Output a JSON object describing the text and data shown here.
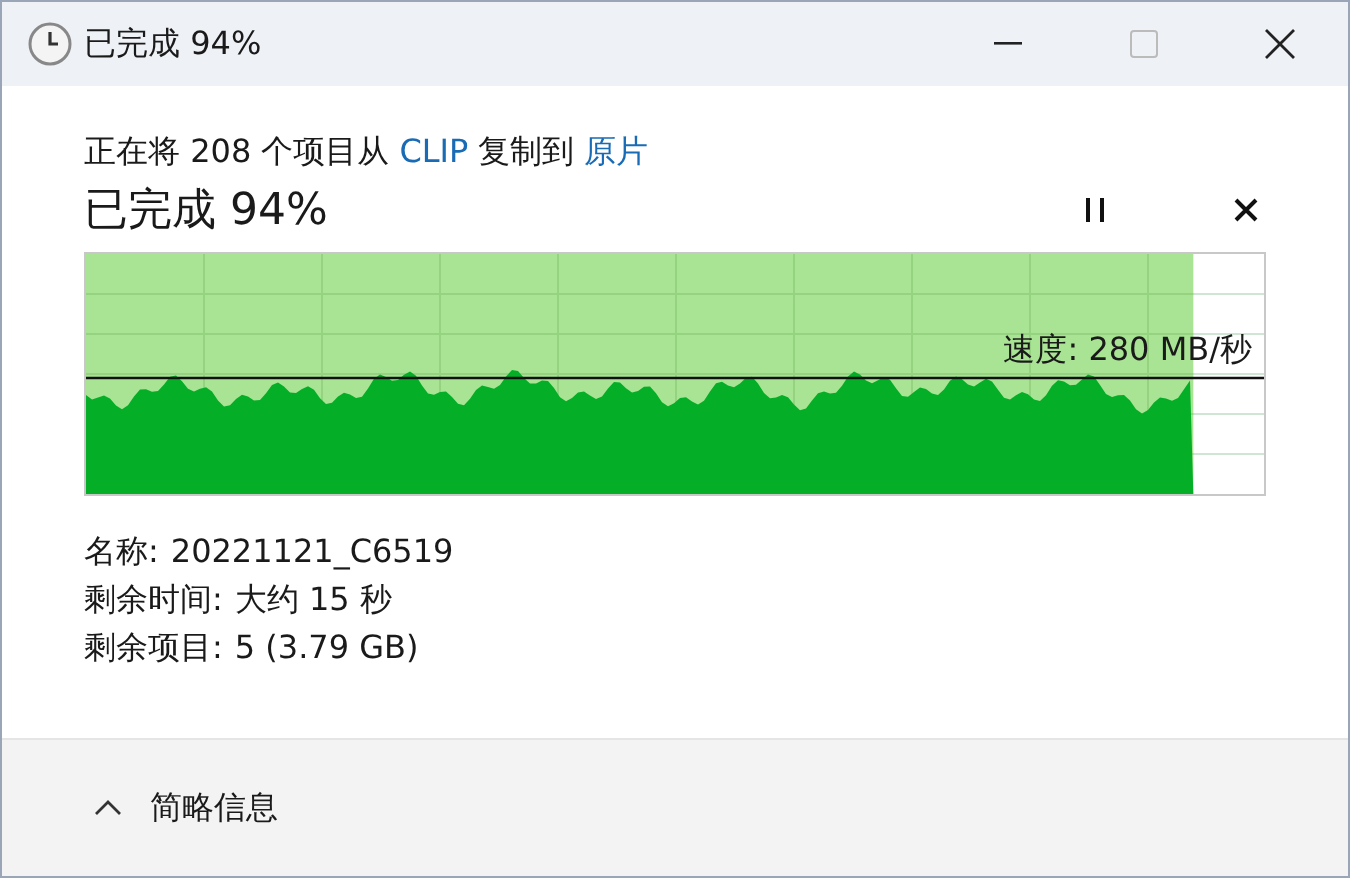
{
  "window": {
    "title": "已完成 94%"
  },
  "description": [
    {
      "kind": "text",
      "text": "正在将 208 个项目从"
    },
    {
      "kind": "link",
      "text": "CLIP"
    },
    {
      "kind": "text",
      "text": "复制到"
    },
    {
      "kind": "link",
      "text": "原片"
    }
  ],
  "progress": {
    "heading": "已完成 94%",
    "level": 0.94,
    "speed": "速度: 280 MB/秒"
  },
  "details": [
    {
      "label": "名称:",
      "value": "20221121_C6519"
    },
    {
      "label": "剩余时间:",
      "value": "大约 15 秒"
    },
    {
      "label": "剩余项目:",
      "value": "5 (3.79 GB)"
    }
  ],
  "footer": {
    "toggle": "简略信息"
  }
}
